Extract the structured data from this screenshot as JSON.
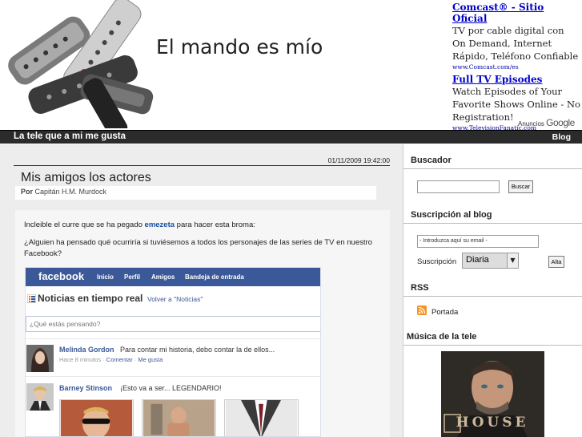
{
  "header": {
    "title": "El mando es mío"
  },
  "ads": [
    {
      "title": "Comcast® - Sitio Oficial",
      "text": "TV por cable digital con On Demand, Internet Rápido, Teléfono Confiable",
      "url": "www.Comcast.com/es"
    },
    {
      "title": "Full TV Episodes",
      "text": "Watch Episodes of Your Favorite Shows Online - No Registration!",
      "url": "www.TelevisionFanatic.com"
    }
  ],
  "ads_footer": {
    "prefix": "Anuncios",
    "brand": "Google"
  },
  "navbar": {
    "tagline": "La tele que a mi me gusta",
    "blog": "Blog"
  },
  "post": {
    "date": "01/11/2009 19:42:00",
    "title": "Mis amigos los actores",
    "author_prefix": "Por",
    "author": "Capitán H.M. Murdock",
    "p1_before": "Incleible el curre que se ha pegado ",
    "p1_link": "emezeta",
    "p1_after": " para hacer esta broma:",
    "p2": "¿Alguien ha pensado qué ocurriría si tuviésemos a todos los personajes de las series de TV en nuestro Facebook?"
  },
  "facebook": {
    "logo": "facebook",
    "nav": [
      "Inicio",
      "Perfil",
      "Amigos",
      "Bandeja de entrada"
    ],
    "feed_title": "Noticias en tiempo real",
    "back_link": "Volver a \"Noticias\"",
    "status_placeholder": "¿Qué estás pensando?",
    "posts": [
      {
        "name": "Melinda Gordon",
        "message": "Para contar mi historia, debo contar la de ellos...",
        "meta": "Hace 8 minutos · ",
        "comment": "Comentar",
        "like": "Me gusta"
      },
      {
        "name": "Barney Stinson",
        "message": "¡Esto va a ser... LEGENDARIO!"
      }
    ]
  },
  "sidebar": {
    "search_title": "Buscador",
    "search_button": "Buscar",
    "subscription_title": "Suscripción al blog",
    "email_placeholder": "- Introduzca aquí su email -",
    "subscription_label": "Suscripción",
    "subscription_value": "Diaria",
    "subscribe_button": "Alta",
    "rss_title": "RSS",
    "rss_link": "Portada",
    "music_title": "Música de la tele",
    "album_logo": "HOUSE"
  },
  "colors": {
    "facebook_blue": "#3b5998",
    "navbar": "#2b2b2b",
    "ad_link": "#0000cc",
    "rss_orange": "#f7931e"
  }
}
